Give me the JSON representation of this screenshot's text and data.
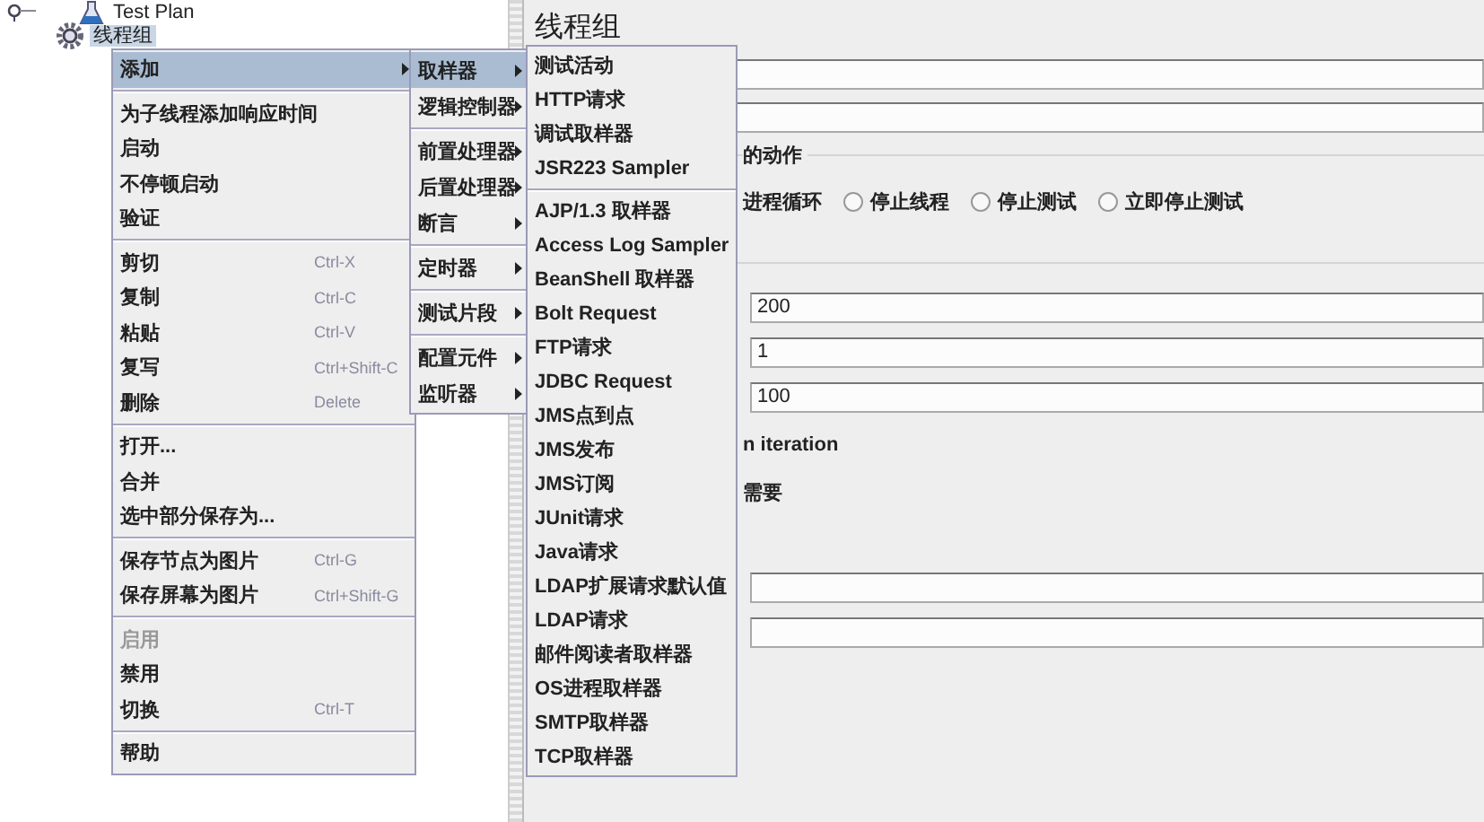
{
  "tree": [
    {
      "label": "Test Plan",
      "selected": false,
      "expanded": true,
      "children": [
        {
          "label": "线程组",
          "selected": true
        }
      ]
    }
  ],
  "panel": {
    "title": "线程组",
    "group_legend": "的动作",
    "partial_option": "进程循环",
    "options": [
      {
        "label": "停止线程",
        "selected": false
      },
      {
        "label": "停止测试",
        "selected": false
      },
      {
        "label": "立即停止测试",
        "selected": false
      }
    ],
    "fields": [
      {
        "value": "200"
      },
      {
        "value": "1"
      },
      {
        "value": "100"
      }
    ],
    "labels": [
      "n iteration",
      "需要"
    ]
  },
  "context_menu": {
    "groups": [
      [
        {
          "label": "添加",
          "selected": true,
          "disabled": false,
          "submenu": true
        }
      ],
      [
        {
          "label": "为子线程添加响应时间",
          "selected": false,
          "disabled": false,
          "submenu": false
        },
        {
          "label": "启动",
          "selected": false,
          "disabled": false,
          "submenu": false
        },
        {
          "label": "不停顿启动",
          "selected": false,
          "disabled": false,
          "submenu": false
        },
        {
          "label": "验证",
          "selected": false,
          "disabled": false,
          "submenu": false
        }
      ],
      [
        {
          "label": "剪切",
          "shortcut": "Ctrl-X",
          "selected": false,
          "disabled": false,
          "submenu": false
        },
        {
          "label": "复制",
          "shortcut": "Ctrl-C",
          "selected": false,
          "disabled": false,
          "submenu": false
        },
        {
          "label": "粘贴",
          "shortcut": "Ctrl-V",
          "selected": false,
          "disabled": false,
          "submenu": false
        },
        {
          "label": "复写",
          "shortcut": "Ctrl+Shift-C",
          "selected": false,
          "disabled": false,
          "submenu": false
        },
        {
          "label": "删除",
          "shortcut": "Delete",
          "selected": false,
          "disabled": false,
          "submenu": false
        }
      ],
      [
        {
          "label": "打开...",
          "selected": false,
          "disabled": false,
          "submenu": false
        },
        {
          "label": "合并",
          "selected": false,
          "disabled": false,
          "submenu": false
        },
        {
          "label": "选中部分保存为...",
          "selected": false,
          "disabled": false,
          "submenu": false
        }
      ],
      [
        {
          "label": "保存节点为图片",
          "shortcut": "Ctrl-G",
          "selected": false,
          "disabled": false,
          "submenu": false
        },
        {
          "label": "保存屏幕为图片",
          "shortcut": "Ctrl+Shift-G",
          "selected": false,
          "disabled": false,
          "submenu": false
        }
      ],
      [
        {
          "label": "启用",
          "selected": false,
          "disabled": true,
          "submenu": false
        },
        {
          "label": "禁用",
          "selected": false,
          "disabled": false,
          "submenu": false
        },
        {
          "label": "切换",
          "shortcut": "Ctrl-T",
          "selected": false,
          "disabled": false,
          "submenu": false
        }
      ],
      [
        {
          "label": "帮助",
          "selected": false,
          "disabled": false,
          "submenu": false
        }
      ]
    ]
  },
  "add_submenu": {
    "groups": [
      [
        {
          "label": "取样器",
          "selected": true,
          "submenu": true
        },
        {
          "label": "逻辑控制器",
          "selected": false,
          "submenu": true
        }
      ],
      [
        {
          "label": "前置处理器",
          "selected": false,
          "submenu": true
        },
        {
          "label": "后置处理器",
          "selected": false,
          "submenu": true
        },
        {
          "label": "断言",
          "selected": false,
          "submenu": true
        }
      ],
      [
        {
          "label": "定时器",
          "selected": false,
          "submenu": true
        }
      ],
      [
        {
          "label": "测试片段",
          "selected": false,
          "submenu": true
        }
      ],
      [
        {
          "label": "配置元件",
          "selected": false,
          "submenu": true
        },
        {
          "label": "监听器",
          "selected": false,
          "submenu": true
        }
      ]
    ]
  },
  "sampler_submenu": {
    "groups": [
      [
        {
          "label": "测试活动",
          "selected": false,
          "submenu": false
        },
        {
          "label": "HTTP请求",
          "selected": false,
          "submenu": false
        },
        {
          "label": "调试取样器",
          "selected": false,
          "submenu": false
        },
        {
          "label": "JSR223 Sampler",
          "selected": false,
          "submenu": false
        }
      ],
      [
        {
          "label": "AJP/1.3 取样器",
          "selected": false,
          "submenu": false
        },
        {
          "label": "Access Log Sampler",
          "selected": false,
          "submenu": false
        },
        {
          "label": "BeanShell 取样器",
          "selected": false,
          "submenu": false
        },
        {
          "label": "Bolt Request",
          "selected": false,
          "submenu": false
        },
        {
          "label": "FTP请求",
          "selected": false,
          "submenu": false
        },
        {
          "label": "JDBC Request",
          "selected": false,
          "submenu": false
        },
        {
          "label": "JMS点到点",
          "selected": false,
          "submenu": false
        },
        {
          "label": "JMS发布",
          "selected": false,
          "submenu": false
        },
        {
          "label": "JMS订阅",
          "selected": false,
          "submenu": false
        },
        {
          "label": "JUnit请求",
          "selected": false,
          "submenu": false
        },
        {
          "label": "Java请求",
          "selected": false,
          "submenu": false
        },
        {
          "label": "LDAP扩展请求默认值",
          "selected": false,
          "submenu": false
        },
        {
          "label": "LDAP请求",
          "selected": false,
          "submenu": false
        },
        {
          "label": "邮件阅读者取样器",
          "selected": false,
          "submenu": false
        },
        {
          "label": "OS进程取样器",
          "selected": false,
          "submenu": false
        },
        {
          "label": "SMTP取样器",
          "selected": false,
          "submenu": false
        },
        {
          "label": "TCP取样器",
          "selected": false,
          "submenu": false
        }
      ]
    ]
  }
}
